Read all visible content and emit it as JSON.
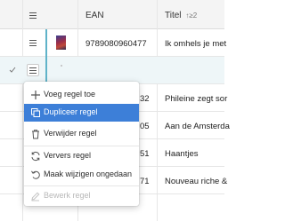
{
  "header": {
    "ean_label": "EAN",
    "title_label": "Titel",
    "sort_indicator": "↑≥2"
  },
  "rows": [
    {
      "ean": "9789080960477",
      "titel": "Ik omhels je met"
    },
    {
      "ean": "",
      "titel": ""
    },
    {
      "ean_suffix": "32",
      "titel": "Phileine zegt sor"
    },
    {
      "ean_suffix": "05",
      "titel": "Aan de Amsterda"
    },
    {
      "ean_suffix": "51",
      "titel": "Haantjes"
    },
    {
      "ean_suffix": "71",
      "titel": "Nouveau riche &"
    }
  ],
  "context_menu": {
    "items": [
      {
        "label": "Voeg regel toe",
        "icon": "plus-icon",
        "state": "normal"
      },
      {
        "label": "Dupliceer regel",
        "icon": "duplicate-icon",
        "state": "active"
      },
      {
        "label": "Verwijder regel",
        "icon": "trash-icon",
        "state": "normal"
      },
      {
        "label": "Ververs regel",
        "icon": "refresh-icon",
        "state": "normal"
      },
      {
        "label": "Maak wijzigen ongedaan",
        "icon": "undo-icon",
        "state": "normal"
      },
      {
        "label": "Bewerk regel",
        "icon": "edit-icon",
        "state": "disabled"
      }
    ]
  },
  "colors": {
    "accent": "#3d7fd8",
    "selection_line": "#5fb3c9"
  }
}
